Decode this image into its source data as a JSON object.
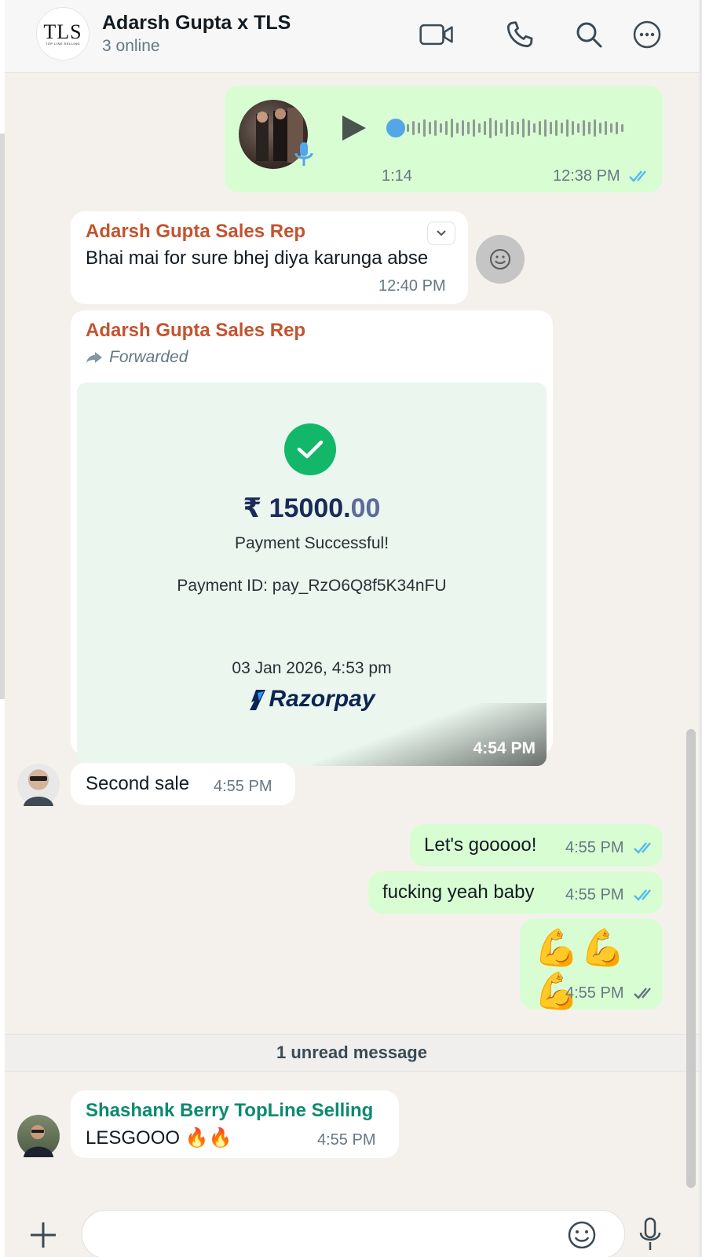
{
  "header": {
    "title": "Adarsh Gupta x TLS",
    "subtitle": "3 online",
    "avatar_text": "TLS",
    "avatar_subtext": "TOP LINE SELLING"
  },
  "messages": {
    "voice": {
      "duration": "1:14",
      "time": "12:38 PM",
      "progress": 0.0
    },
    "m1": {
      "sender": "Adarsh Gupta Sales Rep",
      "text": "Bhai mai for sure bhej diya karunga abse",
      "time": "12:40 PM"
    },
    "m2": {
      "sender": "Adarsh Gupta Sales Rep",
      "forwarded": "Forwarded",
      "amount_main": "₹ 15000.",
      "amount_decimal": "00",
      "status": "Payment Successful!",
      "payment_id": "Payment ID: pay_RzO6Q8f5K34nFU",
      "date": "03 Jan 2026, 4:53 pm",
      "brand": "Razorpay",
      "time": "4:54 PM"
    },
    "m3": {
      "text": "Second sale",
      "time": "4:55 PM"
    },
    "m4": {
      "text": "Let's gooooo!",
      "time": "4:55 PM"
    },
    "m5": {
      "text": "fucking yeah baby",
      "time": "4:55 PM"
    },
    "m6": {
      "text": "💪💪💪",
      "time": "4:55 PM"
    },
    "unread": "1 unread message",
    "m7": {
      "sender": "Shashank Berry TopLine Selling",
      "text": "LESGOOO 🔥🔥",
      "time": "4:55 PM"
    }
  },
  "composer": {
    "placeholder": ""
  },
  "colors": {
    "outgoing": "#d9fdd3",
    "incoming": "#ffffff",
    "read_ticks": "#53bdeb",
    "sender_orange": "#c4532f",
    "sender_green": "#0d8a6e"
  }
}
